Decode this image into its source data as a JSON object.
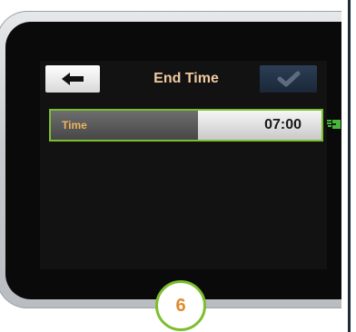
{
  "header": {
    "title": "End Time",
    "back_icon": "arrow-left-icon",
    "confirm_icon": "checkmark-icon"
  },
  "time_row": {
    "label": "Time",
    "value": "07:00",
    "pointer_icon": "pointing-hand-icon"
  },
  "step_badge": {
    "number": "6"
  },
  "colors": {
    "title": "#f0c9a0",
    "time_label": "#f0b45c",
    "selection_border": "#7cbf2e",
    "confirm_button": "#1f2f44",
    "step_number": "#e08a2a"
  }
}
